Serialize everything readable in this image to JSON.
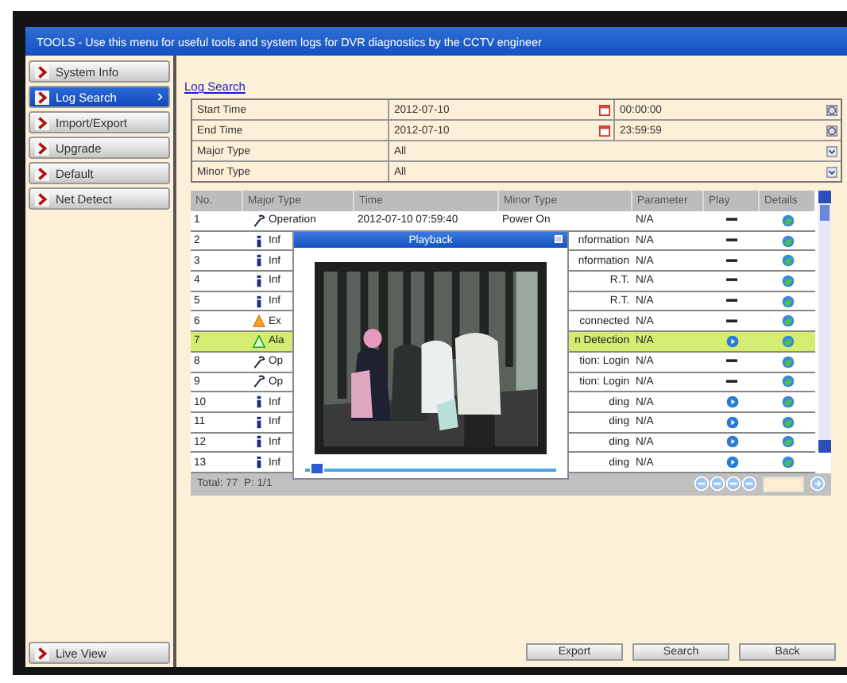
{
  "header": {
    "title": "TOOLS - Use this menu for useful tools and system logs for DVR diagnostics by the CCTV engineer"
  },
  "sidebar": {
    "items": [
      {
        "label": "System Info",
        "selected": false
      },
      {
        "label": "Log Search",
        "selected": true
      },
      {
        "label": "Import/Export",
        "selected": false
      },
      {
        "label": "Upgrade",
        "selected": false
      },
      {
        "label": "Default",
        "selected": false
      },
      {
        "label": "Net Detect",
        "selected": false
      }
    ],
    "footer_item": {
      "label": "Live View",
      "selected": false
    }
  },
  "breadcrumb": "Log Search",
  "form": {
    "rows": [
      {
        "label": "Start Time",
        "date": "2012-07-10",
        "time": "00:00:00",
        "kind": "datetime"
      },
      {
        "label": "End Time",
        "date": "2012-07-10",
        "time": "23:59:59",
        "kind": "datetime"
      },
      {
        "label": "Major Type",
        "value": "All",
        "kind": "select"
      },
      {
        "label": "Minor Type",
        "value": "All",
        "kind": "select"
      }
    ]
  },
  "table": {
    "columns": [
      "No.",
      "Major Type",
      "Time",
      "Minor Type",
      "Parameter",
      "Play",
      "Details"
    ],
    "rows": [
      {
        "no": "1",
        "kind": "operation",
        "major_type": "Operation",
        "time": "2012-07-10 07:59:40",
        "minor_type": "Power On",
        "parameter": "N/A",
        "playable": false,
        "selected": false
      },
      {
        "no": "2",
        "kind": "information",
        "major_type": "Inf",
        "minor_type": "nformation",
        "parameter": "N/A",
        "playable": false,
        "selected": false
      },
      {
        "no": "3",
        "kind": "information",
        "major_type": "Inf",
        "minor_type": "nformation",
        "parameter": "N/A",
        "playable": false,
        "selected": false
      },
      {
        "no": "4",
        "kind": "information",
        "major_type": "Inf",
        "minor_type": "R.T.",
        "parameter": "N/A",
        "playable": false,
        "selected": false
      },
      {
        "no": "5",
        "kind": "information",
        "major_type": "Inf",
        "minor_type": "R.T.",
        "parameter": "N/A",
        "playable": false,
        "selected": false
      },
      {
        "no": "6",
        "kind": "exception",
        "major_type": "Ex",
        "minor_type": "connected",
        "parameter": "N/A",
        "playable": false,
        "selected": false
      },
      {
        "no": "7",
        "kind": "alarm",
        "major_type": "Ala",
        "minor_type": "n Detection",
        "parameter": "N/A",
        "playable": true,
        "selected": true
      },
      {
        "no": "8",
        "kind": "operation",
        "major_type": "Op",
        "minor_type": "tion: Login",
        "parameter": "N/A",
        "playable": false,
        "selected": false
      },
      {
        "no": "9",
        "kind": "operation",
        "major_type": "Op",
        "minor_type": "tion: Login",
        "parameter": "N/A",
        "playable": false,
        "selected": false
      },
      {
        "no": "10",
        "kind": "information",
        "major_type": "Inf",
        "minor_type": "ding",
        "parameter": "N/A",
        "playable": true,
        "selected": false
      },
      {
        "no": "11",
        "kind": "information",
        "major_type": "Inf",
        "minor_type": "ding",
        "parameter": "N/A",
        "playable": true,
        "selected": false
      },
      {
        "no": "12",
        "kind": "information",
        "major_type": "Inf",
        "minor_type": "ding",
        "parameter": "N/A",
        "playable": true,
        "selected": false
      },
      {
        "no": "13",
        "kind": "information",
        "major_type": "Inf",
        "minor_type": "ding",
        "parameter": "N/A",
        "playable": true,
        "selected": false
      }
    ],
    "total": "Total: 77  P: 1/1"
  },
  "playback": {
    "title": "Playback",
    "progress": {
      "level": 0.05
    }
  },
  "buttons": [
    "Export",
    "Search",
    "Back"
  ]
}
